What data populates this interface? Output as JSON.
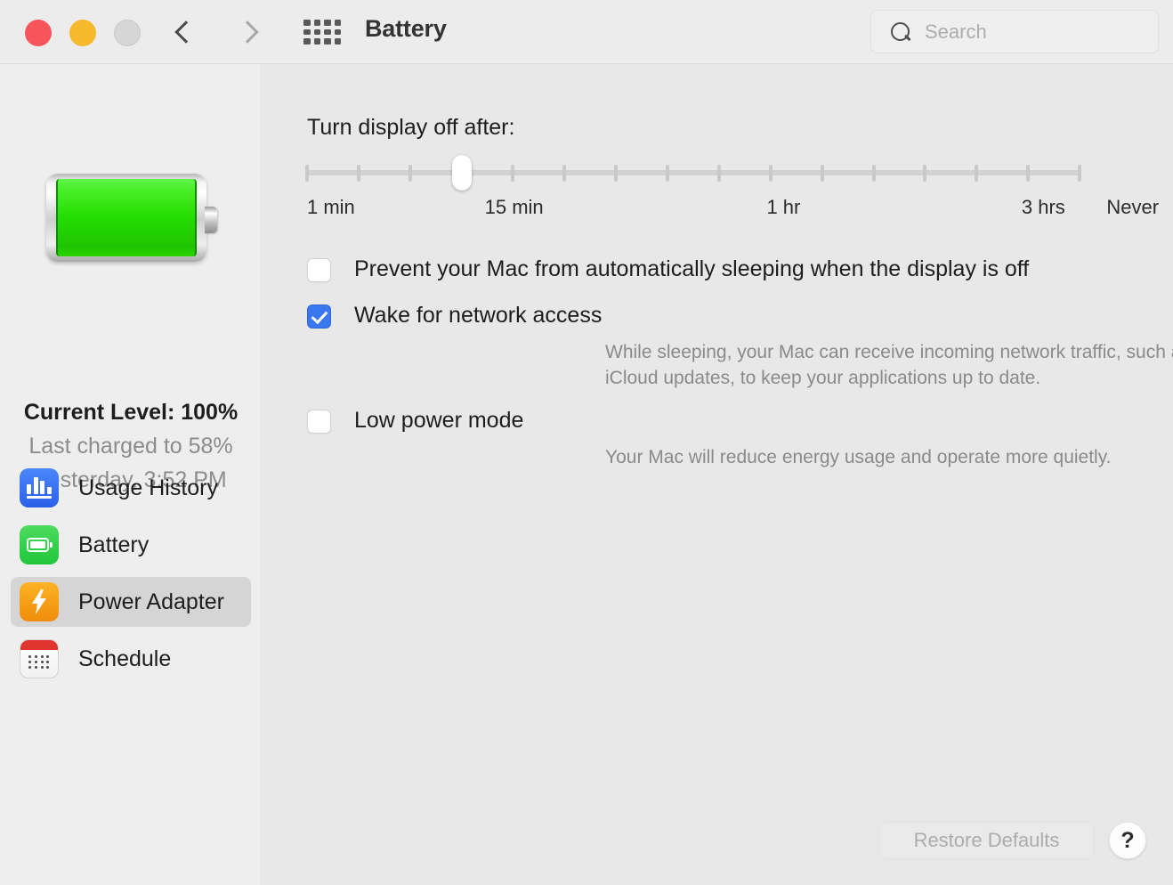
{
  "window": {
    "title": "Battery",
    "traffic_lights": [
      {
        "name": "close-button",
        "color": "#f8555a"
      },
      {
        "name": "minimize-button",
        "color": "#f5b92b"
      },
      {
        "name": "zoom-button",
        "color": "#d6d6d6"
      }
    ],
    "nav": {
      "back": "back-chevron",
      "forward": "forward-chevron"
    },
    "grid_icon": "show-all-grid-icon"
  },
  "search": {
    "placeholder": "Search",
    "value": "",
    "icon": "search-icon"
  },
  "sidebar": {
    "battery_icon": "battery-graphic",
    "status": {
      "current_level": "Current Level: 100%",
      "last_charged": "Last charged to 58%",
      "last_charged_time": "Yesterday, 3:52 PM"
    },
    "items": [
      {
        "label": "Usage History",
        "icon": "usage-history-icon",
        "selected": false
      },
      {
        "label": "Battery",
        "icon": "battery-icon",
        "selected": false
      },
      {
        "label": "Power Adapter",
        "icon": "power-adapter-icon",
        "selected": true
      },
      {
        "label": "Schedule",
        "icon": "schedule-calendar-icon",
        "selected": false
      }
    ]
  },
  "main": {
    "display_off": {
      "title": "Turn display off after:",
      "slider": {
        "tick_count": 16,
        "thumb_index": 3,
        "value": "15 min",
        "labels": [
          {
            "text": "1 min",
            "pos_pct": 0
          },
          {
            "text": "15 min",
            "pos_pct": 23
          },
          {
            "text": "1 hr",
            "pos_pct": 59.5
          },
          {
            "text": "3 hrs",
            "pos_pct": 92.5
          },
          {
            "text": "Never",
            "pos_pct": 103.5
          }
        ]
      }
    },
    "options": [
      {
        "label": "Prevent your Mac from automatically sleeping when the display is off",
        "checked": false,
        "description": ""
      },
      {
        "label": "Wake for network access",
        "checked": true,
        "description": "While sleeping, your Mac can receive incoming network traffic, such as iMessages and other iCloud updates, to keep your applications up to date."
      },
      {
        "label": "Low power mode",
        "checked": false,
        "description": "Your Mac will reduce energy usage and operate more quietly."
      }
    ],
    "restore_defaults_label": "Restore Defaults",
    "help_label": "?"
  },
  "colors": {
    "accent_checkbox": "#3b78f0",
    "selected_row": "#d5d5d5",
    "window_bg": "#ececec",
    "sidebar_bg": "#eeeeee",
    "content_bg": "#e8e8e8"
  }
}
